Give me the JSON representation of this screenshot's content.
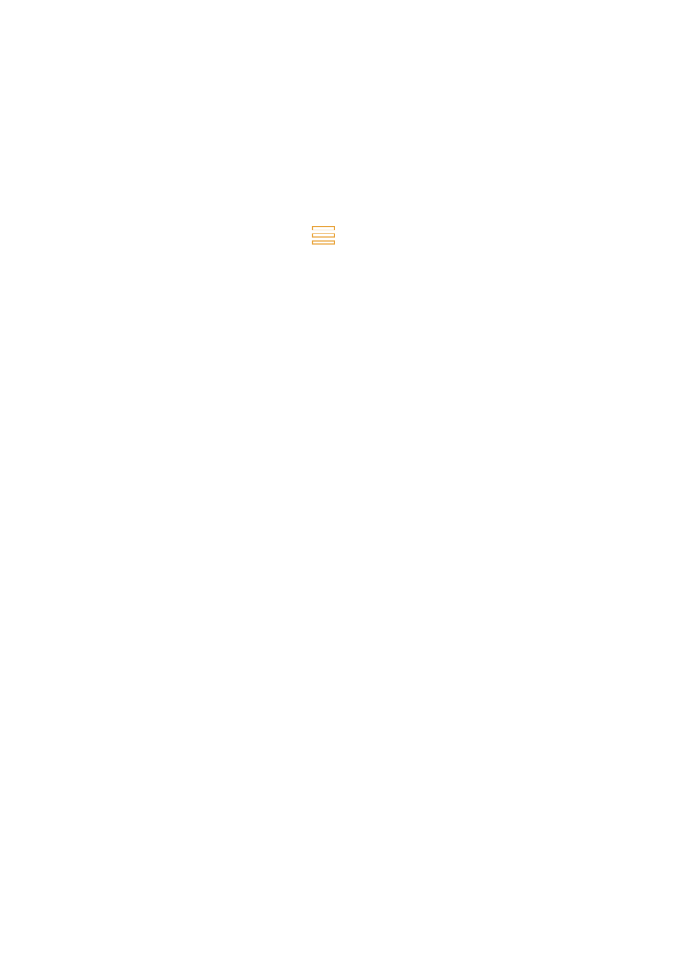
{
  "page": {
    "background": "#ffffff"
  },
  "header": {
    "rule_color": "#000000"
  },
  "icon": {
    "name": "stacked-bars-icon",
    "stroke_color": "#e8a33a",
    "bar_count": 3
  }
}
